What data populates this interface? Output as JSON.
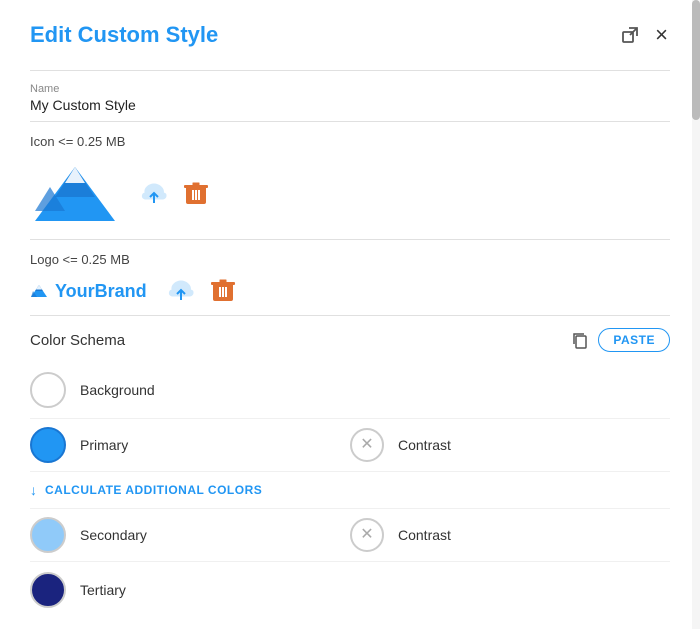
{
  "header": {
    "title": "Edit Custom Style",
    "external_link_icon": "⧉",
    "close_icon": "×"
  },
  "name_field": {
    "label": "Name",
    "value": "My Custom Style"
  },
  "icon_section": {
    "label": "Icon <= 0.25 MB"
  },
  "logo_section": {
    "label": "Logo <= 0.25 MB",
    "logo_text": "YourBrand"
  },
  "color_schema": {
    "title": "Color Schema",
    "copy_label": "copy",
    "paste_label": "PASTE",
    "colors": [
      {
        "name": "Background",
        "swatch": "white",
        "has_contrast": false
      },
      {
        "name": "Primary",
        "swatch": "blue",
        "has_contrast": true,
        "contrast_label": "Contrast"
      },
      {
        "name": "Secondary",
        "swatch": "light-blue",
        "has_contrast": true,
        "contrast_label": "Contrast"
      },
      {
        "name": "Tertiary",
        "swatch": "dark-navy",
        "has_contrast": false
      }
    ],
    "calculate_label": "CALCULATE ADDITIONAL COLORS"
  }
}
